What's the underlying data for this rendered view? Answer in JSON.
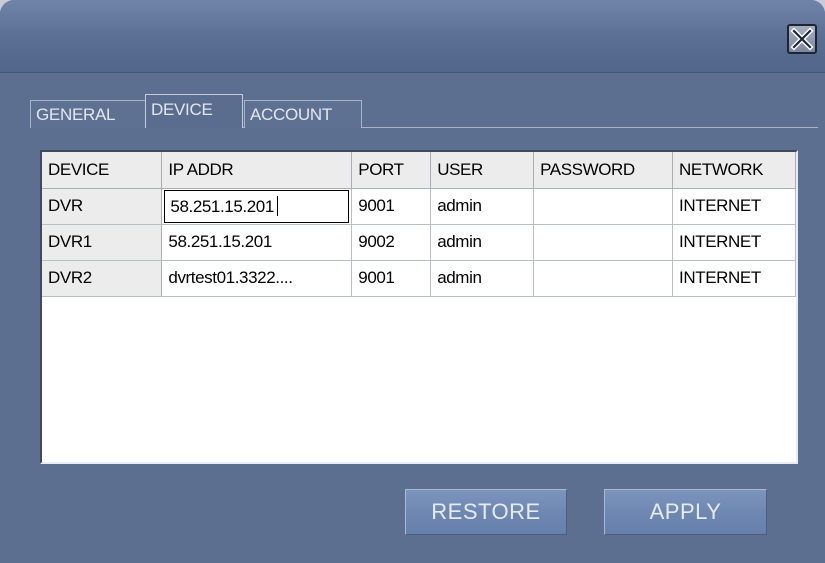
{
  "window": {
    "close_icon": "close-x-icon"
  },
  "tabs": [
    {
      "label": "GENERAL",
      "active": false
    },
    {
      "label": "DEVICE",
      "active": true
    },
    {
      "label": "ACCOUNT",
      "active": false
    }
  ],
  "table": {
    "headers": [
      "DEVICE",
      "IP ADDR",
      "PORT",
      "USER",
      "PASSWORD",
      "NETWORK"
    ],
    "rows": [
      {
        "device": "DVR",
        "ip": "58.251.15.201",
        "port": "9001",
        "user": "admin",
        "password": "",
        "network": "INTERNET",
        "editing_ip": true
      },
      {
        "device": "DVR1",
        "ip": "58.251.15.201",
        "port": "9002",
        "user": "admin",
        "password": "",
        "network": "INTERNET"
      },
      {
        "device": "DVR2",
        "ip": "dvrtest01.3322....",
        "port": "9001",
        "user": "admin",
        "password": "",
        "network": "INTERNET"
      }
    ]
  },
  "buttons": {
    "restore": "RESTORE",
    "apply": "APPLY"
  }
}
